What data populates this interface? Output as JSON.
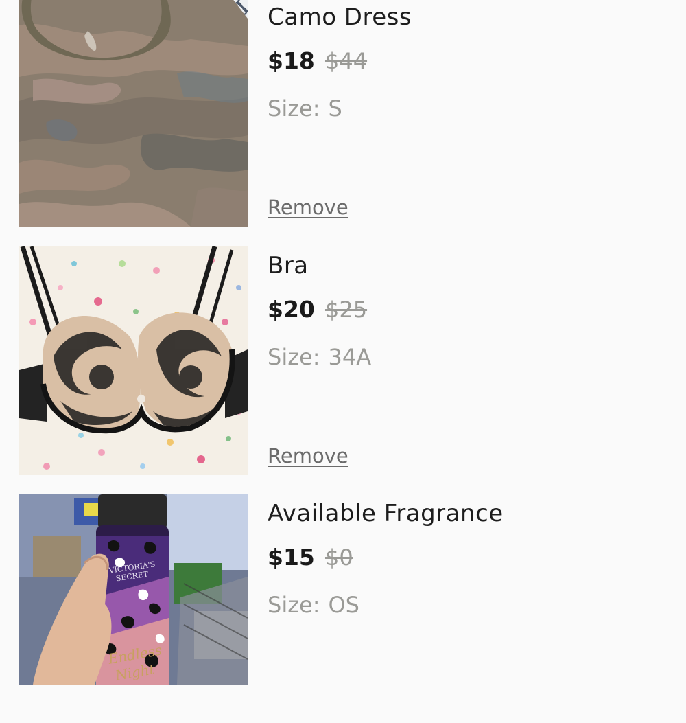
{
  "cart": {
    "items": [
      {
        "title": "Camo Dress",
        "price": "$18",
        "original_price": "$44",
        "size_label": "Size:",
        "size_value": "S",
        "remove_label": "Remove",
        "image_subject": "camouflage-dress-photo"
      },
      {
        "title": "Bra",
        "price": "$20",
        "original_price": "$25",
        "size_label": "Size:",
        "size_value": "34A",
        "remove_label": "Remove",
        "image_subject": "black-lace-bra-photo"
      },
      {
        "title": "Available Fragrance",
        "price": "$15",
        "original_price": "$0",
        "size_label": "Size:",
        "size_value": "OS",
        "remove_label": "",
        "image_subject": "fragrance-bottle-photo",
        "image_text": [
          "VICTORIA'S SECRET",
          "Endless Night"
        ]
      }
    ]
  },
  "colors": {
    "background": "#fafafa",
    "text_primary": "#1d1d1d",
    "text_muted": "#9a9a96",
    "link": "#6b6b6b"
  }
}
